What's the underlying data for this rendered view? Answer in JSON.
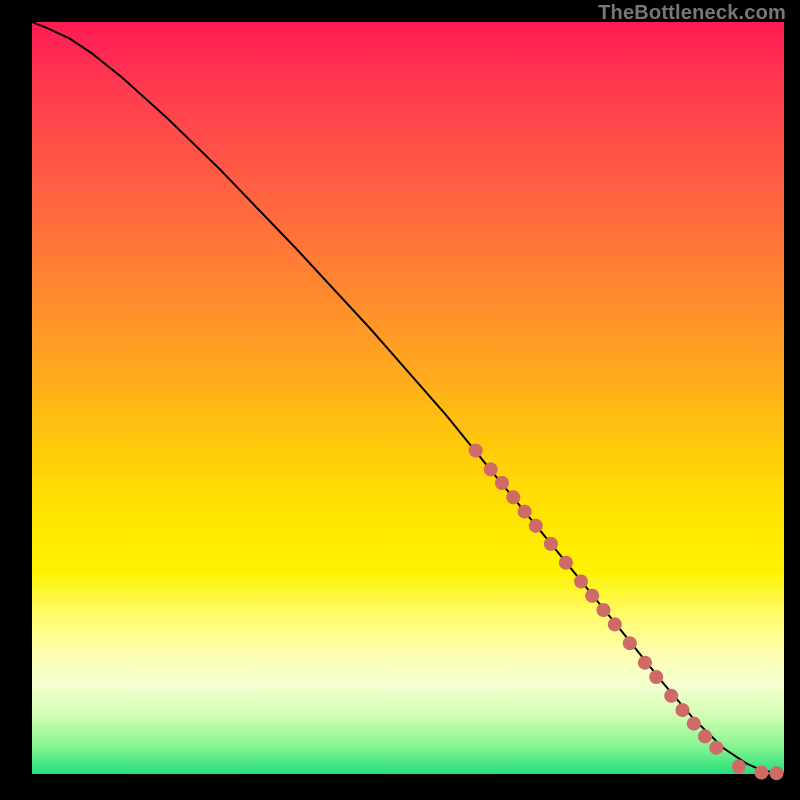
{
  "watermark": "TheBottleneck.com",
  "colors": {
    "dot": "#cf6b67",
    "curve": "#000000",
    "page_bg": "#000000"
  },
  "chart_data": {
    "type": "line",
    "title": "",
    "xlabel": "",
    "ylabel": "",
    "xlim": [
      0,
      100
    ],
    "ylim": [
      0,
      100
    ],
    "grid": false,
    "legend": false,
    "series": [
      {
        "name": "curve",
        "kind": "line",
        "x": [
          0,
          2,
          5,
          8,
          12,
          18,
          25,
          35,
          45,
          55,
          62,
          70,
          78,
          84,
          88,
          92,
          95,
          97,
          99,
          100
        ],
        "y": [
          100,
          99.2,
          97.8,
          95.8,
          92.6,
          87.2,
          80.4,
          70.0,
          59.2,
          47.8,
          39.2,
          29.4,
          19.5,
          12.0,
          7.3,
          3.4,
          1.4,
          0.5,
          0.15,
          0.1
        ]
      },
      {
        "name": "highlight-points",
        "kind": "scatter",
        "x": [
          59,
          61,
          62.5,
          64,
          65.5,
          67,
          69,
          71,
          73,
          74.5,
          76,
          77.5,
          79.5,
          81.5,
          83,
          85,
          86.5,
          88,
          89.5,
          91,
          94,
          97,
          99
        ],
        "y": [
          43.0,
          40.5,
          38.7,
          36.8,
          34.9,
          33.0,
          30.6,
          28.1,
          25.6,
          23.7,
          21.8,
          19.9,
          17.4,
          14.8,
          12.9,
          10.4,
          8.5,
          6.7,
          5.0,
          3.5,
          1.0,
          0.2,
          0.1
        ]
      }
    ]
  }
}
